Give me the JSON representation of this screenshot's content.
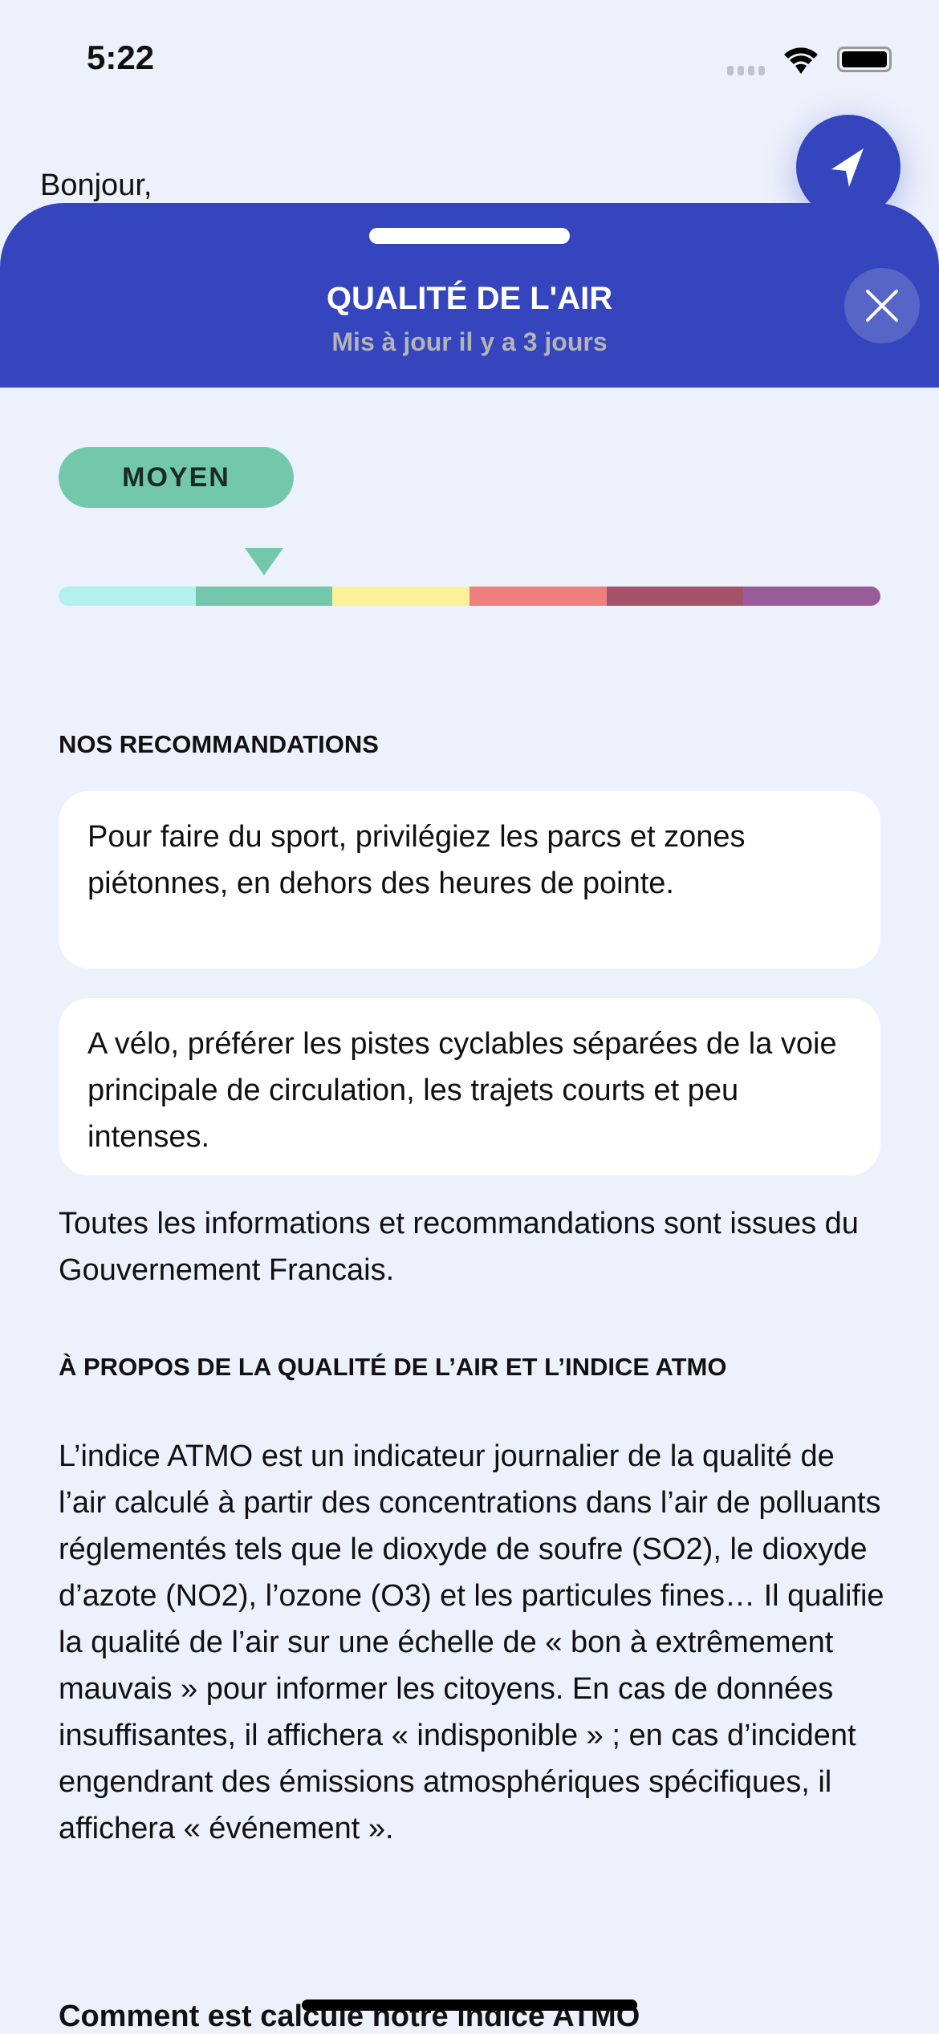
{
  "status_bar": {
    "time": "5:22"
  },
  "background": {
    "greeting": "Bonjour,"
  },
  "sheet": {
    "title": "QUALITÉ DE L'AIR",
    "subtitle": "Mis à jour il y a 3 jours",
    "level_label": "MOYEN",
    "level_index": 1,
    "scale_colors": [
      "#b1f2ee",
      "#73c8ac",
      "#fbf19b",
      "#ee7f7d",
      "#a6516a",
      "#9a5b9a"
    ],
    "recommendations_heading": "NOS RECOMMANDATIONS",
    "recommendations": [
      "Pour faire du sport, privilégiez les parcs et zones piétonnes, en dehors des heures de pointe.",
      "A vélo, préférer les pistes cyclables séparées de la voie principale de circulation, les trajets courts et peu intenses."
    ],
    "source_note": "Toutes les informations et recommandations sont issues du Gouvernement Francais.",
    "about_heading": "À PROPOS DE LA QUALITÉ DE L’AIR ET L’INDICE ATMO",
    "about_text": "L’indice ATMO est un indicateur journalier de la qualité de l’air calculé à partir des concentrations dans l’air de polluants réglementés tels que le dioxyde de soufre (SO2), le dioxyde d’azote (NO2), l’ozone (O3) et les particules fines… Il qualifie la qualité de l’air sur une échelle de « bon à extrêmement mauvais » pour informer les citoyens. En cas de données insuffisantes, il affichera « indisponible » ; en cas d’incident engendrant des émissions atmosphériques spécifiques, il affichera « événement ».",
    "calc_heading": "Comment est calcule notre indice ATMO"
  },
  "colors": {
    "accent": "#3445bd",
    "background": "#edf1fb"
  }
}
